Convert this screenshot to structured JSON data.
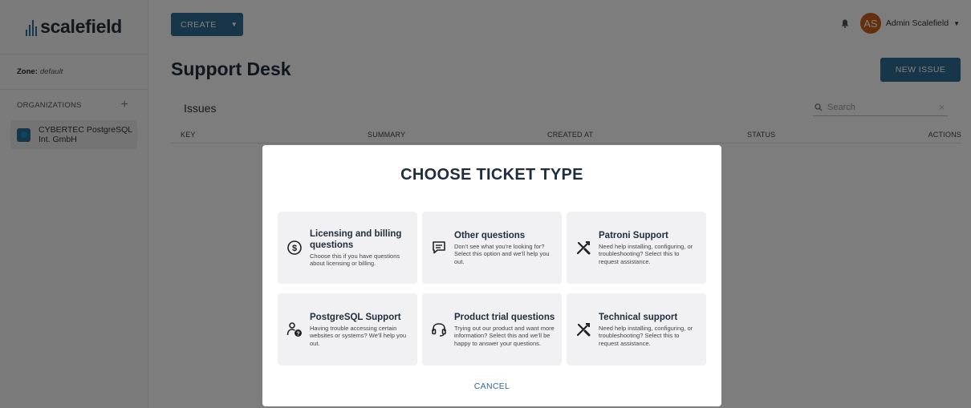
{
  "app": {
    "logo_text": "scalefield"
  },
  "sidebar": {
    "zone_label": "Zone:",
    "zone_value": "default",
    "organizations_label": "ORGANIZATIONS",
    "add_icon": "plus",
    "org": {
      "name_line1": "CYBERTEC PostgreSQL",
      "name_line2": "Int. GmbH"
    }
  },
  "topbar": {
    "create_label": "CREATE",
    "user_initials": "AS",
    "user_name": "Admin Scalefield",
    "avatar_color": "#c95e1c"
  },
  "page": {
    "title": "Support Desk",
    "new_issue_label": "NEW ISSUE",
    "issues_label": "Issues",
    "search_placeholder": "Search",
    "columns": [
      "KEY",
      "SUMMARY",
      "CREATED AT",
      "STATUS",
      "ACTIONS"
    ]
  },
  "modal": {
    "title": "CHOOSE TICKET TYPE",
    "cancel_label": "CANCEL",
    "cards": [
      {
        "icon": "dollar-icon",
        "title": "Licensing and billing questions",
        "desc": "Choose this if you have questions about licensing or billing."
      },
      {
        "icon": "message-icon",
        "title": "Other questions",
        "desc": "Don't see what you're looking for? Select this option and we'll help you out."
      },
      {
        "icon": "tools-icon",
        "title": "Patroni Support",
        "desc": "Need help installing, configuring, or troubleshooting? Select this to request assistance."
      },
      {
        "icon": "user-help-icon",
        "title": "PostgreSQL Support",
        "desc": "Having trouble accessing certain websites or systems? We'll help you out."
      },
      {
        "icon": "headset-icon",
        "title": "Product trial questions",
        "desc": "Trying out our product and want more information? Select this and we'll be happy to answer your questions."
      },
      {
        "icon": "tools-icon",
        "title": "Technical support",
        "desc": "Need help installing, configuring, or troubleshooting? Select this to request assistance."
      }
    ]
  },
  "colors": {
    "primary": "#2f6c92",
    "overlay": "rgba(0,0,0,0.5)"
  }
}
